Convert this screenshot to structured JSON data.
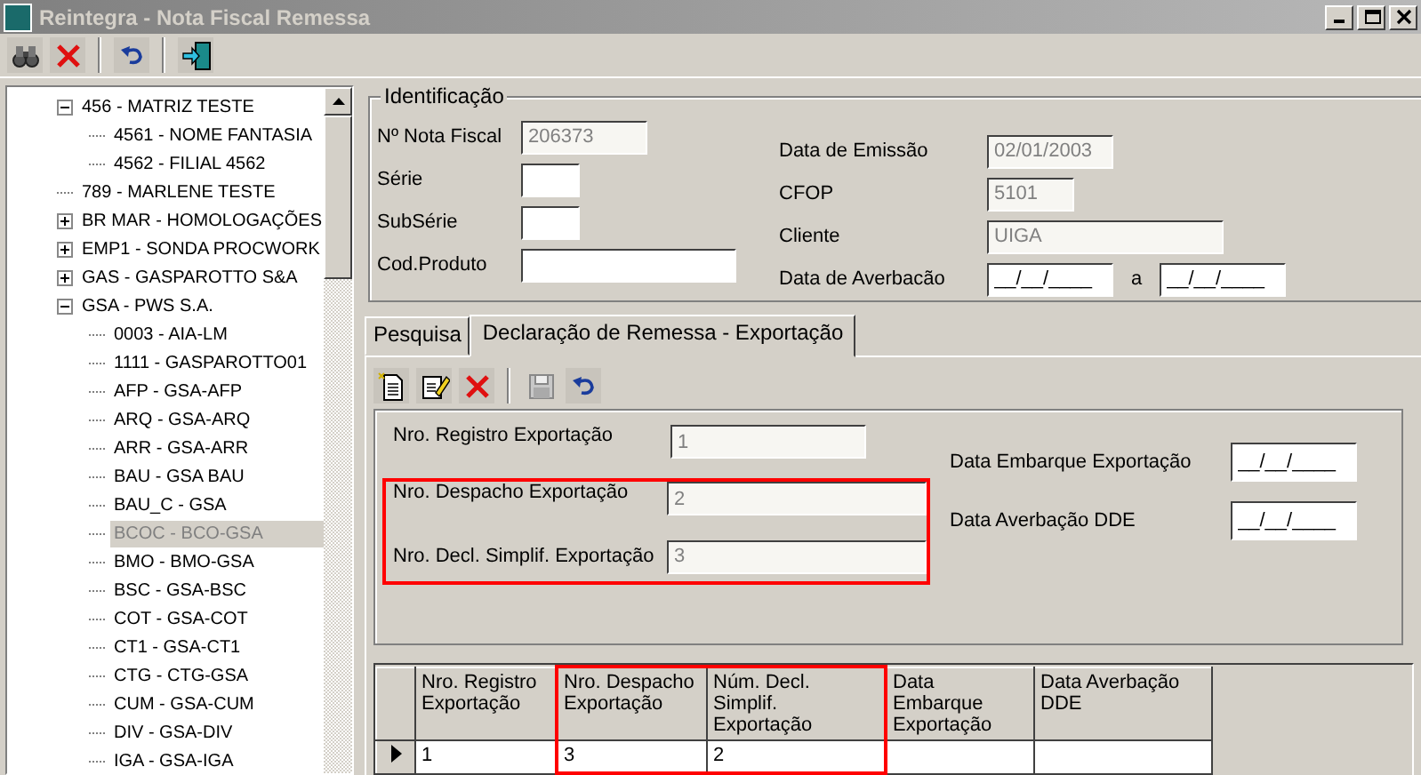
{
  "window": {
    "title": "Reintegra - Nota Fiscal Remessa"
  },
  "toolbar": [
    {
      "kind": "find"
    },
    {
      "kind": "delete"
    },
    {
      "kind": "sep"
    },
    {
      "kind": "undo"
    },
    {
      "kind": "sep"
    },
    {
      "kind": "exit"
    }
  ],
  "tree": [
    {
      "label": "456 - MATRIZ TESTE",
      "expanded": true,
      "selected": false,
      "children": [
        {
          "label": "4561 - NOME FANTASIA",
          "selected": false
        },
        {
          "label": "4562 - FILIAL 4562",
          "selected": false
        }
      ]
    },
    {
      "label": "789 - MARLENE TESTE",
      "selected": false
    },
    {
      "label": "BR MAR - HOMOLOGAÇÕES",
      "expanded": false,
      "selected": false
    },
    {
      "label": "EMP1 - SONDA PROCWORK",
      "expanded": false,
      "selected": false
    },
    {
      "label": "GAS - GASPAROTTO S&A",
      "expanded": false,
      "selected": false
    },
    {
      "label": "GSA - PWS S.A.",
      "expanded": true,
      "selected": false,
      "children": [
        {
          "label": "0003 - AIA-LM",
          "selected": false
        },
        {
          "label": "1111 - GASPAROTTO01",
          "selected": false
        },
        {
          "label": "AFP - GSA-AFP",
          "selected": false
        },
        {
          "label": "ARQ - GSA-ARQ",
          "selected": false
        },
        {
          "label": "ARR - GSA-ARR",
          "selected": false
        },
        {
          "label": "BAU - GSA BAU",
          "selected": false
        },
        {
          "label": "BAU_C - GSA",
          "selected": false
        },
        {
          "label": "BCOC - BCO-GSA",
          "selected": true
        },
        {
          "label": "BMO - BMO-GSA",
          "selected": false
        },
        {
          "label": "BSC - GSA-BSC",
          "selected": false
        },
        {
          "label": "COT - GSA-COT",
          "selected": false
        },
        {
          "label": "CT1 - GSA-CT1",
          "selected": false
        },
        {
          "label": "CTG - CTG-GSA",
          "selected": false
        },
        {
          "label": "CUM - GSA-CUM",
          "selected": false
        },
        {
          "label": "DIV - GSA-DIV",
          "selected": false
        },
        {
          "label": "IGA - GSA-IGA",
          "selected": false
        }
      ]
    }
  ],
  "identificacao": {
    "title": "Identificação",
    "left": [
      {
        "label": "Nº Nota Fiscal",
        "kind": "number",
        "value": "206373",
        "disabled": true
      },
      {
        "label": "Série",
        "kind": "code",
        "disabled": false
      },
      {
        "label": "SubSérie",
        "kind": "code",
        "disabled": false
      },
      {
        "label": "Cod.Produto",
        "kind": "text",
        "disabled": false
      }
    ],
    "right": [
      {
        "label": "Data de Emissão",
        "kind": "date",
        "value": "02/01/2003",
        "disabled": true
      },
      {
        "label": "CFOP",
        "kind": "short",
        "value": "5101",
        "disabled": true
      },
      {
        "label": "Cliente",
        "kind": "long",
        "value": "UIGA",
        "disabled": true
      },
      {
        "label": "Data de Averbacão",
        "kind": "range",
        "value": "__/__/____",
        "separator": "a",
        "value_to": "__/__/____",
        "disabled": false
      }
    ]
  },
  "tabs": [
    {
      "label": "Pesquisa",
      "selected": false
    },
    {
      "label": "Declaração de Remessa - Exportação",
      "selected": true
    }
  ],
  "record_toolbar": [
    {
      "kind": "new",
      "disabled": false
    },
    {
      "kind": "edit",
      "disabled": false
    },
    {
      "kind": "delete",
      "disabled": false
    },
    {
      "kind": "sep"
    },
    {
      "kind": "save",
      "disabled": true
    },
    {
      "kind": "undo",
      "disabled": false
    }
  ],
  "exportacao": {
    "left": [
      {
        "label": "Nro. Registro Exportação",
        "value": "1",
        "highlighted": false
      },
      {
        "label": "Nro. Despacho Exportação",
        "value": "2",
        "highlighted": true
      },
      {
        "label": "Nro. Decl. Simplif. Exportação",
        "value": "3",
        "highlighted": true
      }
    ],
    "right": [
      {
        "label": "Data Embarque Exportação",
        "value": "__/__/____"
      },
      {
        "label": "Data Averbação DDE",
        "value": "__/__/____"
      }
    ]
  },
  "table": {
    "columns": [
      {
        "label": "Nro. Registro Exportação",
        "highlighted": false
      },
      {
        "label": "Nro. Despacho Exportação",
        "highlighted": true
      },
      {
        "label": "Núm. Decl. Simplif. Exportação",
        "highlighted": true
      },
      {
        "label": "Data Embarque Exportação",
        "highlighted": false
      },
      {
        "label": "Data Averbação DDE",
        "highlighted": false
      }
    ],
    "rows": [
      {
        "current": true,
        "cells": [
          "1",
          "3",
          "2"
        ]
      }
    ]
  }
}
